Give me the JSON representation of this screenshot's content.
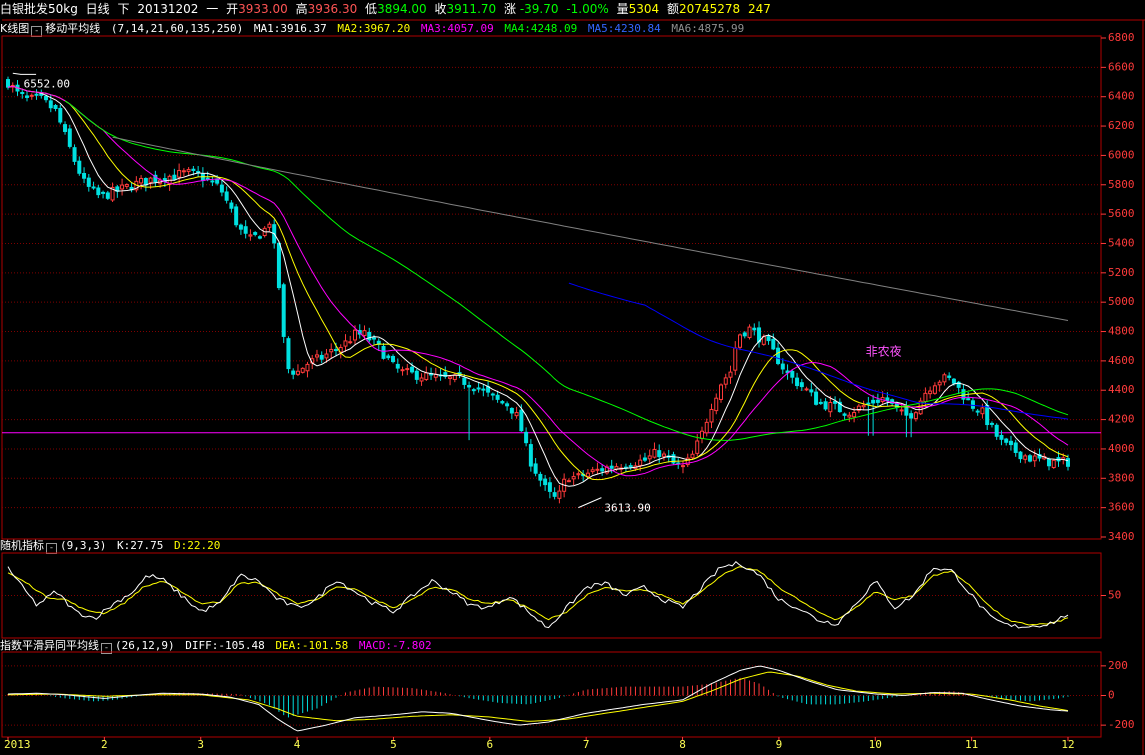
{
  "title_bar": {
    "symbol": "白银批发50kg",
    "period": "日线",
    "adjust": "下",
    "date": "20131202",
    "weekday": "一",
    "open_label": "开",
    "open": "3933.00",
    "high_label": "高",
    "high": "3936.30",
    "low_label": "低",
    "low": "3894.00",
    "close_label": "收",
    "close": "3911.70",
    "change_label": "涨",
    "change": "-39.70",
    "change_pct": "-1.00%",
    "volume_label": "量",
    "volume": "5304",
    "amount_label": "额",
    "amount": "20745278",
    "extra": "247"
  },
  "colors": {
    "up": "#ff3b3b",
    "down": "#00e0e0",
    "frame": "#b00000",
    "grid": "#800000",
    "ma1": "#ffffff",
    "ma2": "#ffff00",
    "ma3": "#ff00ff",
    "ma4": "#00ff00",
    "ma5": "#0000ff",
    "ma6": "#808080",
    "k": "#ffffff",
    "d": "#ffff00",
    "macd": "#ff00ff",
    "axis": "#ff3b3b"
  },
  "main_header": {
    "icon": "K-line-toggle-icon",
    "chart_name": "K线图",
    "indicator_name": "移动平均线",
    "params": "(7,14,21,60,135,250)",
    "ma1": "MA1:3916.37",
    "ma2": "MA2:3967.20",
    "ma3": "MA3:4057.09",
    "ma4": "MA4:4248.09",
    "ma5": "MA5:4230.84",
    "ma6": "MA6:4875.99"
  },
  "kdj_header": {
    "name": "随机指标",
    "params": "(9,3,3)",
    "k": "K:27.75",
    "d": "D:22.20"
  },
  "macd_header": {
    "name": "指数平滑异同平均线",
    "params": "(26,12,9)",
    "diff": "DIFF:-105.48",
    "dea": "DEA:-101.58",
    "macd": "MACD:-7.802"
  },
  "annotations": {
    "high_label": "6552.00",
    "low_label": "3613.90",
    "event_label": "非农夜",
    "event_x_month": 9.9
  },
  "chart_data": [
    {
      "type": "candlestick",
      "ylim": [
        3400,
        6800
      ],
      "y_ticks": [
        3400,
        3600,
        3800,
        4000,
        4200,
        4400,
        4600,
        4800,
        5000,
        5200,
        5400,
        5600,
        5800,
        6000,
        6200,
        6400,
        6600,
        6800
      ],
      "x_tick_labels": [
        "2013",
        "2",
        "3",
        "4",
        "5",
        "6",
        "7",
        "8",
        "9",
        "10",
        "11",
        "12"
      ],
      "x_tick_positions": [
        1,
        2,
        3,
        4,
        5,
        6,
        7,
        8,
        9,
        10,
        11,
        12
      ],
      "reference_level": 4110,
      "price_path": [
        [
          1.0,
          6500
        ],
        [
          1.1,
          6420
        ],
        [
          1.2,
          6380
        ],
        [
          1.35,
          6380
        ],
        [
          1.5,
          6300
        ],
        [
          1.6,
          6120
        ],
        [
          1.7,
          5950
        ],
        [
          1.8,
          5800
        ],
        [
          1.95,
          5720
        ],
        [
          2.1,
          5750
        ],
        [
          2.3,
          5800
        ],
        [
          2.5,
          5840
        ],
        [
          2.7,
          5860
        ],
        [
          2.85,
          5880
        ],
        [
          3.0,
          5860
        ],
        [
          3.2,
          5780
        ],
        [
          3.3,
          5650
        ],
        [
          3.4,
          5500
        ],
        [
          3.5,
          5420
        ],
        [
          3.65,
          5480
        ],
        [
          3.72,
          5560
        ],
        [
          3.8,
          5200
        ],
        [
          3.85,
          4800
        ],
        [
          3.9,
          4550
        ],
        [
          4.0,
          4520
        ],
        [
          4.1,
          4580
        ],
        [
          4.25,
          4620
        ],
        [
          4.4,
          4680
        ],
        [
          4.5,
          4720
        ],
        [
          4.6,
          4780
        ],
        [
          4.7,
          4780
        ],
        [
          4.8,
          4720
        ],
        [
          4.9,
          4650
        ],
        [
          5.0,
          4560
        ],
        [
          5.1,
          4520
        ],
        [
          5.3,
          4500
        ],
        [
          5.5,
          4480
        ],
        [
          5.7,
          4470
        ],
        [
          5.85,
          4430
        ],
        [
          6.0,
          4360
        ],
        [
          6.1,
          4320
        ],
        [
          6.2,
          4300
        ],
        [
          6.3,
          4200
        ],
        [
          6.4,
          3950
        ],
        [
          6.5,
          3820
        ],
        [
          6.6,
          3700
        ],
        [
          6.7,
          3650
        ],
        [
          6.8,
          3820
        ],
        [
          6.9,
          3800
        ],
        [
          7.0,
          3830
        ],
        [
          7.2,
          3870
        ],
        [
          7.4,
          3900
        ],
        [
          7.6,
          3920
        ],
        [
          7.75,
          3980
        ],
        [
          7.9,
          3900
        ],
        [
          8.0,
          3870
        ],
        [
          8.1,
          3950
        ],
        [
          8.2,
          4100
        ],
        [
          8.3,
          4300
        ],
        [
          8.4,
          4450
        ],
        [
          8.5,
          4530
        ],
        [
          8.55,
          4700
        ],
        [
          8.6,
          4790
        ],
        [
          8.7,
          4820
        ],
        [
          8.8,
          4760
        ],
        [
          8.9,
          4700
        ],
        [
          9.0,
          4600
        ],
        [
          9.1,
          4500
        ],
        [
          9.2,
          4450
        ],
        [
          9.3,
          4390
        ],
        [
          9.4,
          4320
        ],
        [
          9.5,
          4300
        ],
        [
          9.6,
          4280
        ],
        [
          9.7,
          4250
        ],
        [
          9.8,
          4270
        ],
        [
          9.9,
          4300
        ],
        [
          10.0,
          4330
        ],
        [
          10.1,
          4350
        ],
        [
          10.2,
          4280
        ],
        [
          10.3,
          4220
        ],
        [
          10.4,
          4250
        ],
        [
          10.5,
          4370
        ],
        [
          10.6,
          4450
        ],
        [
          10.7,
          4480
        ],
        [
          10.8,
          4470
        ],
        [
          10.9,
          4380
        ],
        [
          11.0,
          4300
        ],
        [
          11.1,
          4260
        ],
        [
          11.2,
          4150
        ],
        [
          11.3,
          4050
        ],
        [
          11.4,
          4000
        ],
        [
          11.5,
          3970
        ],
        [
          11.6,
          3940
        ],
        [
          11.75,
          3920
        ],
        [
          11.9,
          3905
        ],
        [
          12.0,
          3912
        ]
      ],
      "spikes": [
        {
          "x": 5.8,
          "low": 4060
        },
        {
          "x": 9.95,
          "low": 4090
        },
        {
          "x": 10.35,
          "low": 4080
        }
      ]
    },
    {
      "type": "line",
      "name": "KDJ",
      "ylim": [
        0,
        100
      ],
      "y_ticks": [
        50
      ],
      "k_points": [
        [
          1.0,
          85
        ],
        [
          1.15,
          60
        ],
        [
          1.3,
          38
        ],
        [
          1.5,
          55
        ],
        [
          1.7,
          30
        ],
        [
          1.9,
          22
        ],
        [
          2.1,
          40
        ],
        [
          2.3,
          55
        ],
        [
          2.45,
          75
        ],
        [
          2.6,
          70
        ],
        [
          2.8,
          50
        ],
        [
          3.0,
          30
        ],
        [
          3.2,
          40
        ],
        [
          3.4,
          75
        ],
        [
          3.6,
          68
        ],
        [
          3.8,
          45
        ],
        [
          4.0,
          35
        ],
        [
          4.2,
          45
        ],
        [
          4.4,
          70
        ],
        [
          4.6,
          55
        ],
        [
          4.8,
          40
        ],
        [
          5.0,
          30
        ],
        [
          5.2,
          50
        ],
        [
          5.4,
          68
        ],
        [
          5.6,
          55
        ],
        [
          5.8,
          38
        ],
        [
          6.0,
          35
        ],
        [
          6.2,
          50
        ],
        [
          6.4,
          30
        ],
        [
          6.6,
          10
        ],
        [
          6.8,
          35
        ],
        [
          7.0,
          60
        ],
        [
          7.2,
          65
        ],
        [
          7.4,
          50
        ],
        [
          7.6,
          60
        ],
        [
          7.8,
          45
        ],
        [
          8.0,
          35
        ],
        [
          8.2,
          60
        ],
        [
          8.4,
          85
        ],
        [
          8.6,
          90
        ],
        [
          8.8,
          75
        ],
        [
          9.0,
          45
        ],
        [
          9.2,
          35
        ],
        [
          9.4,
          20
        ],
        [
          9.6,
          15
        ],
        [
          9.8,
          40
        ],
        [
          10.0,
          68
        ],
        [
          10.2,
          35
        ],
        [
          10.4,
          50
        ],
        [
          10.6,
          85
        ],
        [
          10.8,
          80
        ],
        [
          11.0,
          50
        ],
        [
          11.2,
          22
        ],
        [
          11.4,
          12
        ],
        [
          11.6,
          12
        ],
        [
          11.8,
          15
        ],
        [
          11.9,
          20
        ],
        [
          12.0,
          27.75
        ]
      ],
      "d_points": [
        [
          1.0,
          78
        ],
        [
          1.2,
          65
        ],
        [
          1.4,
          48
        ],
        [
          1.6,
          45
        ],
        [
          1.8,
          32
        ],
        [
          2.0,
          28
        ],
        [
          2.2,
          40
        ],
        [
          2.4,
          60
        ],
        [
          2.6,
          68
        ],
        [
          2.8,
          55
        ],
        [
          3.0,
          40
        ],
        [
          3.2,
          42
        ],
        [
          3.4,
          65
        ],
        [
          3.6,
          66
        ],
        [
          3.8,
          52
        ],
        [
          4.0,
          40
        ],
        [
          4.2,
          45
        ],
        [
          4.4,
          60
        ],
        [
          4.6,
          58
        ],
        [
          4.8,
          45
        ],
        [
          5.0,
          35
        ],
        [
          5.2,
          45
        ],
        [
          5.4,
          60
        ],
        [
          5.6,
          58
        ],
        [
          5.8,
          45
        ],
        [
          6.0,
          40
        ],
        [
          6.2,
          45
        ],
        [
          6.4,
          35
        ],
        [
          6.6,
          20
        ],
        [
          6.8,
          30
        ],
        [
          7.0,
          50
        ],
        [
          7.2,
          60
        ],
        [
          7.4,
          55
        ],
        [
          7.6,
          57
        ],
        [
          7.8,
          50
        ],
        [
          8.0,
          40
        ],
        [
          8.2,
          55
        ],
        [
          8.4,
          75
        ],
        [
          8.6,
          85
        ],
        [
          8.8,
          80
        ],
        [
          9.0,
          60
        ],
        [
          9.2,
          45
        ],
        [
          9.4,
          30
        ],
        [
          9.6,
          20
        ],
        [
          9.8,
          35
        ],
        [
          10.0,
          55
        ],
        [
          10.2,
          45
        ],
        [
          10.4,
          50
        ],
        [
          10.6,
          75
        ],
        [
          10.8,
          80
        ],
        [
          11.0,
          60
        ],
        [
          11.2,
          35
        ],
        [
          11.4,
          18
        ],
        [
          11.6,
          14
        ],
        [
          11.8,
          15
        ],
        [
          11.9,
          18
        ],
        [
          12.0,
          22.2
        ]
      ]
    },
    {
      "type": "line",
      "name": "MACD",
      "ylim": [
        -280,
        280
      ],
      "y_ticks": [
        200,
        0,
        -200
      ],
      "diff_points": [
        [
          1.0,
          10
        ],
        [
          1.3,
          15
        ],
        [
          1.6,
          5
        ],
        [
          2.0,
          -20
        ],
        [
          2.3,
          0
        ],
        [
          2.6,
          15
        ],
        [
          3.0,
          10
        ],
        [
          3.3,
          -10
        ],
        [
          3.6,
          -60
        ],
        [
          3.8,
          -160
        ],
        [
          4.0,
          -240
        ],
        [
          4.3,
          -200
        ],
        [
          4.6,
          -150
        ],
        [
          5.0,
          -130
        ],
        [
          5.3,
          -110
        ],
        [
          5.6,
          -120
        ],
        [
          6.0,
          -170
        ],
        [
          6.3,
          -200
        ],
        [
          6.6,
          -180
        ],
        [
          7.0,
          -120
        ],
        [
          7.3,
          -90
        ],
        [
          7.6,
          -60
        ],
        [
          8.0,
          -30
        ],
        [
          8.3,
          80
        ],
        [
          8.6,
          170
        ],
        [
          8.8,
          200
        ],
        [
          9.0,
          170
        ],
        [
          9.3,
          100
        ],
        [
          9.6,
          40
        ],
        [
          10.0,
          10
        ],
        [
          10.3,
          0
        ],
        [
          10.6,
          20
        ],
        [
          10.9,
          15
        ],
        [
          11.2,
          -30
        ],
        [
          11.5,
          -70
        ],
        [
          11.8,
          -95
        ],
        [
          12.0,
          -105.48
        ]
      ],
      "dea_points": [
        [
          1.0,
          5
        ],
        [
          1.5,
          10
        ],
        [
          2.0,
          -5
        ],
        [
          2.5,
          5
        ],
        [
          3.0,
          5
        ],
        [
          3.5,
          -30
        ],
        [
          3.8,
          -90
        ],
        [
          4.0,
          -140
        ],
        [
          4.4,
          -170
        ],
        [
          4.8,
          -160
        ],
        [
          5.2,
          -140
        ],
        [
          5.6,
          -130
        ],
        [
          6.0,
          -145
        ],
        [
          6.4,
          -175
        ],
        [
          6.8,
          -160
        ],
        [
          7.2,
          -120
        ],
        [
          7.6,
          -80
        ],
        [
          8.0,
          -40
        ],
        [
          8.3,
          30
        ],
        [
          8.6,
          110
        ],
        [
          8.9,
          160
        ],
        [
          9.2,
          130
        ],
        [
          9.5,
          70
        ],
        [
          9.8,
          30
        ],
        [
          10.2,
          10
        ],
        [
          10.6,
          15
        ],
        [
          11.0,
          10
        ],
        [
          11.4,
          -30
        ],
        [
          11.7,
          -70
        ],
        [
          12.0,
          -101.58
        ]
      ],
      "hist_points": [
        [
          1.0,
          10
        ],
        [
          1.3,
          10
        ],
        [
          1.6,
          -20
        ],
        [
          1.9,
          -40
        ],
        [
          2.1,
          -30
        ],
        [
          2.5,
          10
        ],
        [
          2.8,
          20
        ],
        [
          3.0,
          15
        ],
        [
          3.4,
          10
        ],
        [
          3.7,
          -60
        ],
        [
          3.9,
          -150
        ],
        [
          4.2,
          -90
        ],
        [
          4.5,
          20
        ],
        [
          4.8,
          60
        ],
        [
          5.2,
          50
        ],
        [
          5.5,
          20
        ],
        [
          5.8,
          -20
        ],
        [
          6.1,
          -50
        ],
        [
          6.4,
          -60
        ],
        [
          6.7,
          -20
        ],
        [
          7.0,
          40
        ],
        [
          7.4,
          60
        ],
        [
          7.8,
          60
        ],
        [
          8.0,
          60
        ],
        [
          8.3,
          80
        ],
        [
          8.6,
          120
        ],
        [
          8.8,
          80
        ],
        [
          9.0,
          -10
        ],
        [
          9.3,
          -60
        ],
        [
          9.6,
          -60
        ],
        [
          9.9,
          -40
        ],
        [
          10.2,
          -10
        ],
        [
          10.5,
          20
        ],
        [
          10.8,
          30
        ],
        [
          11.0,
          10
        ],
        [
          11.3,
          -20
        ],
        [
          11.6,
          -40
        ],
        [
          11.9,
          -20
        ],
        [
          12.0,
          -7.8
        ]
      ]
    }
  ]
}
